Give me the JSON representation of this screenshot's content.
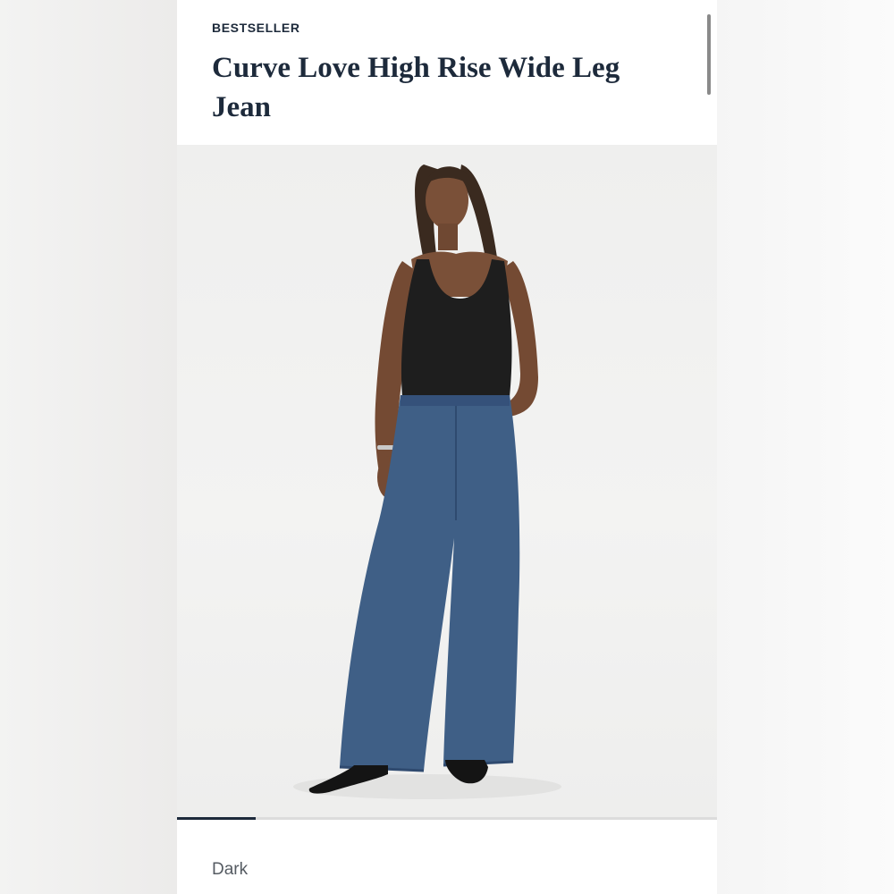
{
  "product": {
    "badge": "BESTSELLER",
    "title": "Curve Love High Rise Wide Leg Jean",
    "color_label": "Dark"
  },
  "gallery": {
    "image_alt": "Model wearing black tank top and high rise wide leg jeans",
    "progress": 0.145
  },
  "colors": {
    "text_primary": "#1d2a3b",
    "denim": "#3f5f86",
    "top": "#1e1e1e"
  }
}
